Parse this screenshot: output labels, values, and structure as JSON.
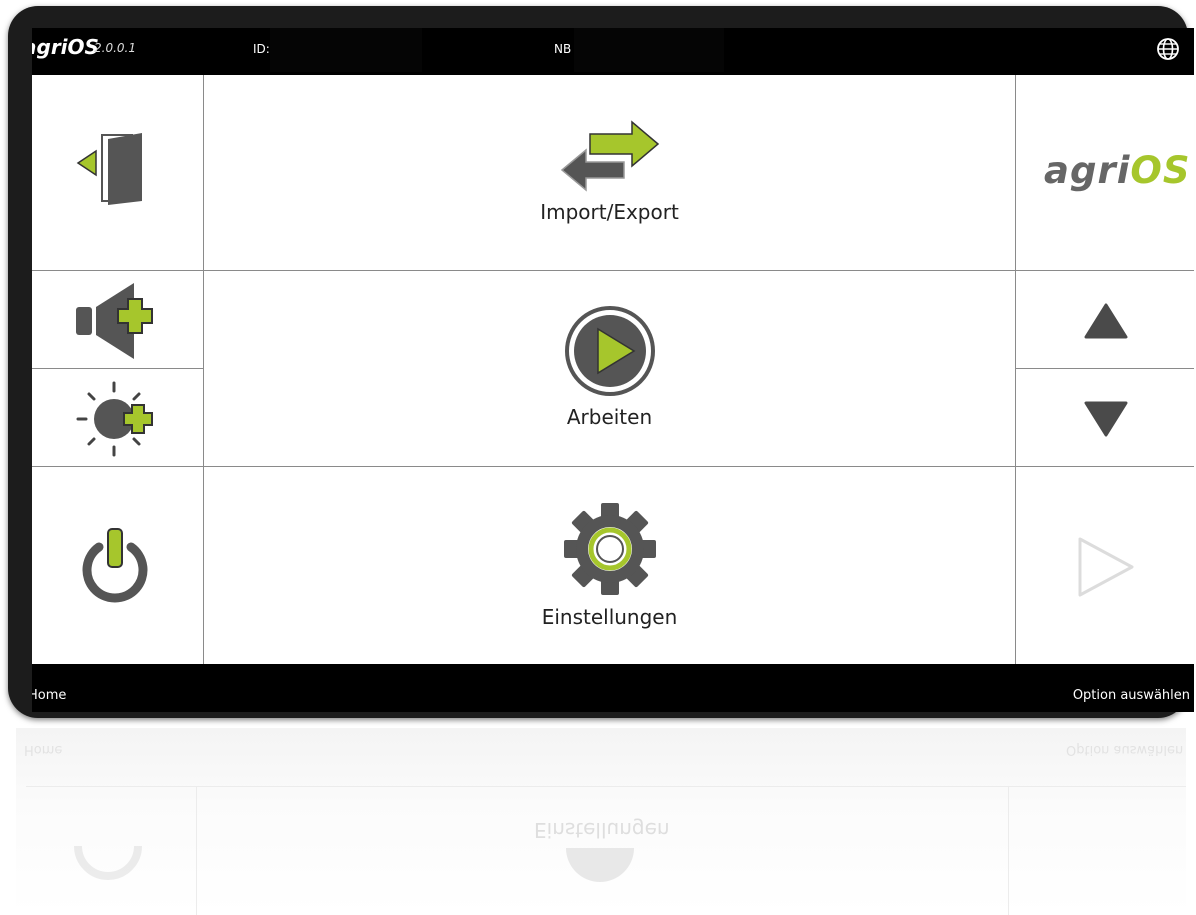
{
  "header": {
    "brand": "agriOS",
    "version": "2.0.0.1",
    "id_label": "ID:",
    "nb_label": "NB",
    "globe_icon": "globe-icon"
  },
  "left_column": {
    "exit_icon": "exit-door-icon",
    "volume_up_icon": "volume-plus-icon",
    "brightness_up_icon": "brightness-plus-icon",
    "power_icon": "power-icon"
  },
  "center_column": {
    "import_export": "Import/Export",
    "work": "Arbeiten",
    "settings": "Einstellungen"
  },
  "right_column": {
    "logo_dark": "agri",
    "logo_green": "OS",
    "up_icon": "triangle-up-icon",
    "down_icon": "triangle-down-icon",
    "next_icon": "play-outline-icon"
  },
  "footer": {
    "left": "Home",
    "right": "Option auswählen"
  },
  "colors": {
    "accent": "#a6c62c",
    "icon_dark": "#555555",
    "bar": "#000000"
  }
}
